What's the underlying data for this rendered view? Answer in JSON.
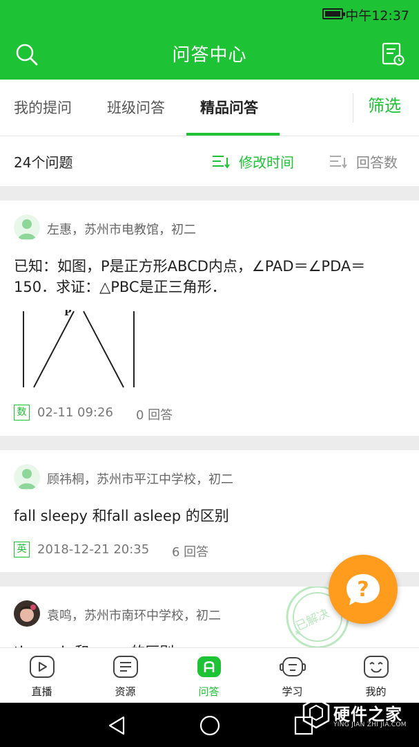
{
  "status_bar": {
    "time": "中午12:37"
  },
  "header": {
    "title": "问答中心"
  },
  "tabs": [
    {
      "label": "我的提问"
    },
    {
      "label": "班级问答"
    },
    {
      "label": "精品问答"
    }
  ],
  "filter_label": "筛选",
  "sort_bar": {
    "count": "24个问题",
    "options": [
      {
        "label": "修改时间"
      },
      {
        "label": "回答数"
      }
    ]
  },
  "questions": [
    {
      "author": "左惠，苏州市电教馆，初二",
      "text": "已知：如图，P是正方形ABCD内点，∠PAD＝∠PDA＝150．求证：△PBC是正三角形．",
      "figure_label": "P",
      "subject": "数",
      "date": "02-11 09:26",
      "answers": "0 回答"
    },
    {
      "author": "顾祎桐，苏州市平江中学校，初二",
      "text": "fall sleepy 和fall asleep 的区别",
      "subject": "英",
      "date": "2018-12-21 20:35",
      "answers": "6 回答"
    },
    {
      "author": "袁鸣，苏州市南环中学校，初二",
      "text": "th... ...b 和 ... ... 的区别",
      "stamp": "已解决"
    }
  ],
  "fab_symbol": "?",
  "bottom_tabs": [
    {
      "label": "直播",
      "icon": "video-icon"
    },
    {
      "label": "资源",
      "icon": "document-icon"
    },
    {
      "label": "问答",
      "icon": "qa-icon"
    },
    {
      "label": "学习",
      "icon": "robot-icon"
    },
    {
      "label": "我的",
      "icon": "smiley-icon"
    }
  ],
  "watermark": {
    "title": "硬件之家",
    "subtitle": "YING JIAN ZHI JIA.COM"
  },
  "colors": {
    "accent": "#1ec235",
    "fab": "#ff9c1e"
  }
}
